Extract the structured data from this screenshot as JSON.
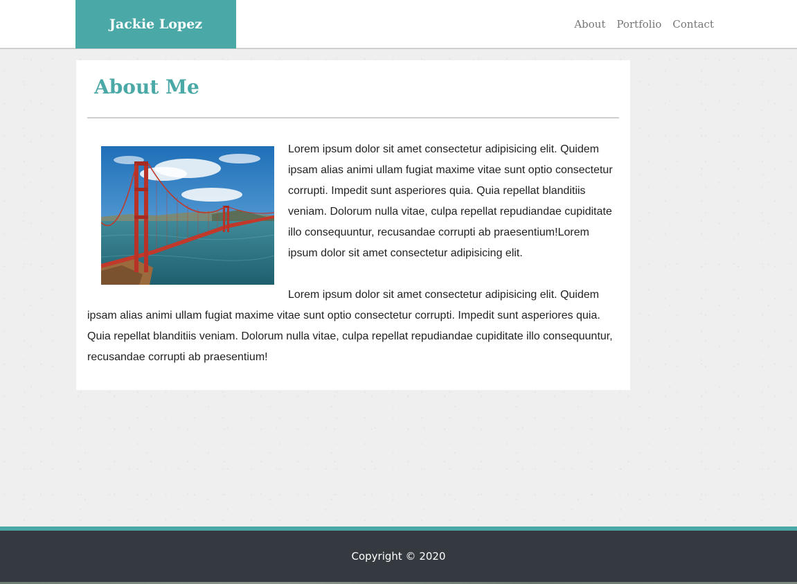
{
  "header": {
    "brand": "Jackie Lopez",
    "nav": [
      {
        "label": "About"
      },
      {
        "label": "Portfolio"
      },
      {
        "label": "Contact"
      }
    ]
  },
  "about": {
    "title": "About Me",
    "image_subject": "Golden Gate Bridge",
    "paragraphs": [
      "Lorem ipsum dolor sit amet consectetur adipisicing elit. Quidem ipsam alias animi ullam fugiat maxime vitae sunt optio consectetur corrupti. Impedit sunt asperiores quia. Quia repellat blanditiis veniam. Dolorum nulla vitae, culpa repellat repudiandae cupiditate illo consequuntur, recusandae corrupti ab praesentium!Lorem ipsum dolor sit amet consectetur adipisicing elit.",
      "Lorem ipsum dolor sit amet consectetur adipisicing elit. Quidem ipsam alias animi ullam fugiat maxime vitae sunt optio consectetur corrupti. Impedit sunt asperiores quia. Quia repellat blanditiis veniam. Dolorum nulla vitae, culpa repellat repudiandae cupiditate illo consequuntur, recusandae corrupti ab praesentium!"
    ]
  },
  "footer": {
    "copyright": "Copyright © 2020"
  },
  "colors": {
    "accent": "#4aa8a6",
    "footer_bg": "#343a40",
    "nav_text": "#767676",
    "body_text": "#222222"
  }
}
